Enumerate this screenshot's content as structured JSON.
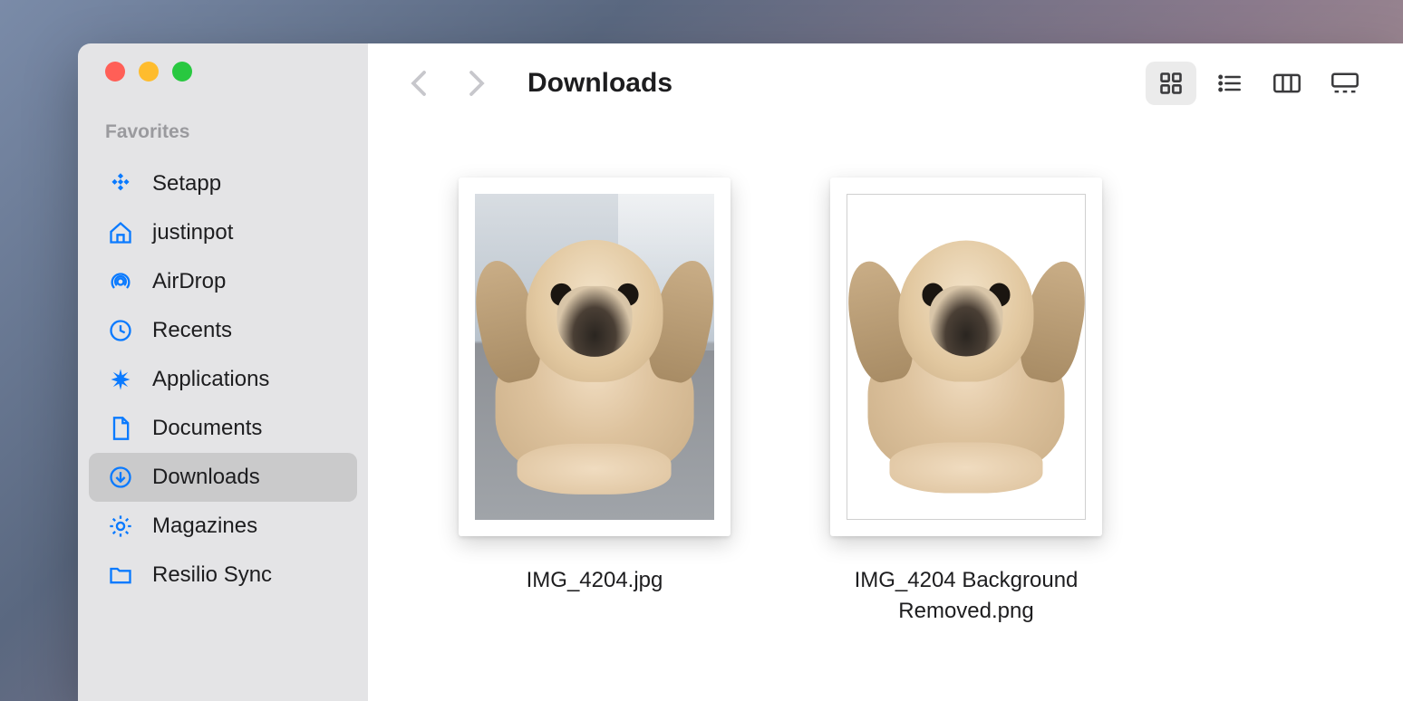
{
  "window": {
    "title": "Downloads"
  },
  "sidebar": {
    "section": "Favorites",
    "items": [
      {
        "label": "Setapp",
        "icon": "setapp"
      },
      {
        "label": "justinpot",
        "icon": "home"
      },
      {
        "label": "AirDrop",
        "icon": "airdrop"
      },
      {
        "label": "Recents",
        "icon": "clock"
      },
      {
        "label": "Applications",
        "icon": "apps"
      },
      {
        "label": "Documents",
        "icon": "document"
      },
      {
        "label": "Downloads",
        "icon": "download",
        "selected": true
      },
      {
        "label": "Magazines",
        "icon": "gear"
      },
      {
        "label": "Resilio Sync",
        "icon": "folder"
      }
    ]
  },
  "view_mode": "icons",
  "files": [
    {
      "name": "IMG_4204.jpg"
    },
    {
      "name": "IMG_4204 Background Removed.png"
    }
  ]
}
